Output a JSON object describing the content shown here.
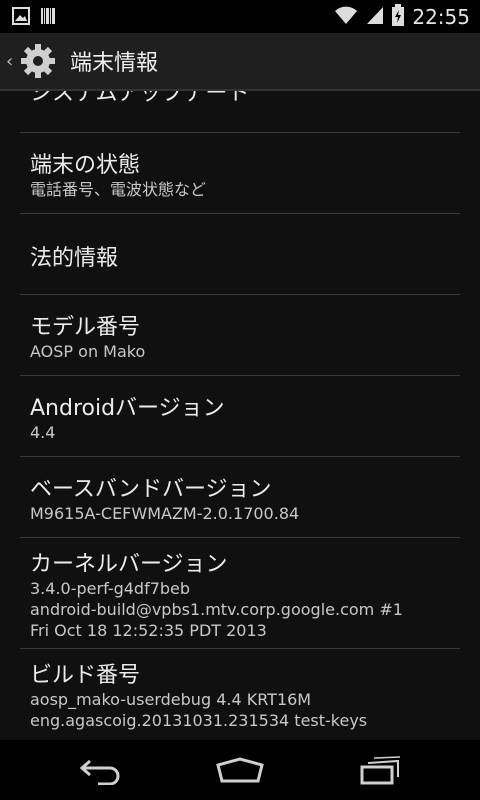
{
  "status_bar": {
    "time": "22:55",
    "left_icons": [
      "image-icon",
      "barcode-icon"
    ],
    "right_icons": [
      "wifi-icon",
      "signal-icon",
      "battery-icon"
    ]
  },
  "action_bar": {
    "title": "端末情報",
    "icons": [
      "back-chevron-icon",
      "settings-gear-icon"
    ]
  },
  "list": {
    "partial_item_title": "システムアップデート",
    "items": [
      {
        "title": "端末の状態",
        "subtitle": [
          "電話番号、電波状態など"
        ]
      },
      {
        "title": "法的情報",
        "subtitle": []
      },
      {
        "title": "モデル番号",
        "subtitle": [
          "AOSP on Mako"
        ]
      },
      {
        "title": "Androidバージョン",
        "subtitle": [
          "4.4"
        ]
      },
      {
        "title": "ベースバンドバージョン",
        "subtitle": [
          "M9615A-CEFWMAZM-2.0.1700.84"
        ]
      },
      {
        "title": "カーネルバージョン",
        "subtitle": [
          "3.4.0-perf-g4df7beb",
          "android-build@vpbs1.mtv.corp.google.com #1",
          "Fri Oct 18 12:52:35 PDT 2013"
        ]
      },
      {
        "title": "ビルド番号",
        "subtitle": [
          "aosp_mako-userdebug 4.4 KRT16M",
          "eng.agascoig.20131031.231534 test-keys"
        ]
      }
    ]
  },
  "nav_bar": {
    "icons": [
      "back-icon",
      "home-icon",
      "recent-apps-icon"
    ]
  }
}
